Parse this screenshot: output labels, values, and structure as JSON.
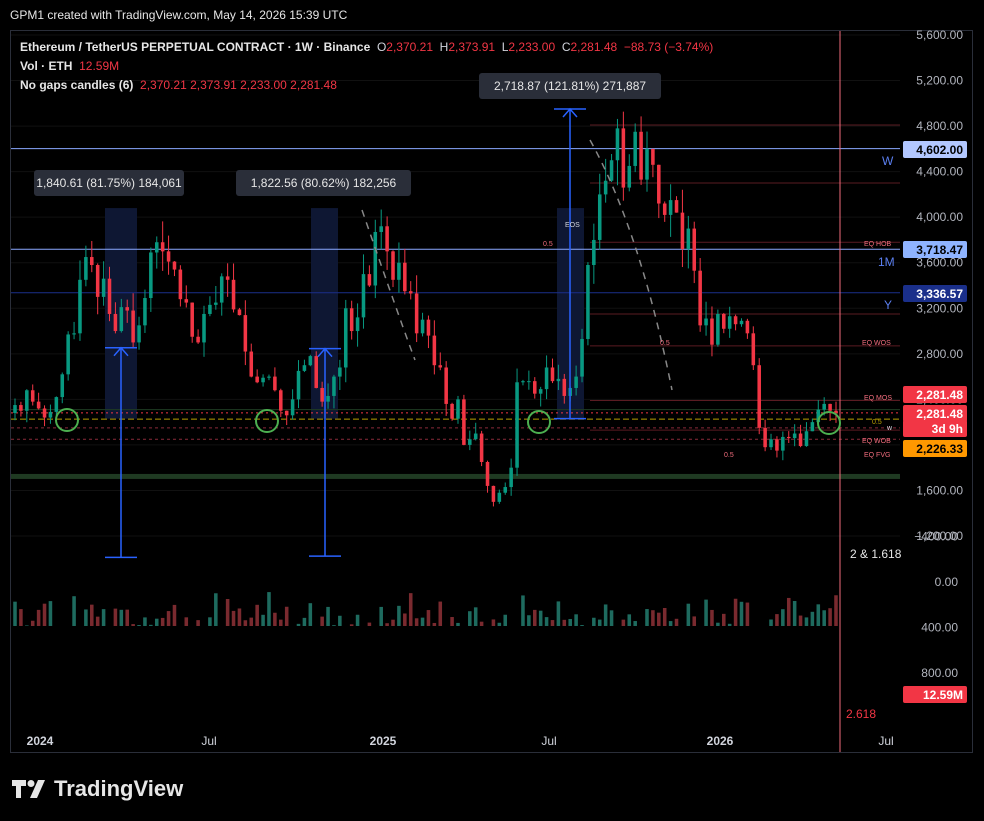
{
  "header": {
    "credit": "GPM1 created with TradingView.com, May 14, 2026 15:39 UTC"
  },
  "legend": {
    "symbol": "Ethereum / TetherUS PERPETUAL CONTRACT · 1W · Binance",
    "o_label": "O",
    "o": "2,370.21",
    "h_label": "H",
    "h": "2,373.91",
    "l_label": "L",
    "l": "2,233.00",
    "c_label": "C",
    "c": "2,281.48",
    "change": "−88.73 (−3.74%)",
    "vol_label": "Vol · ETH",
    "vol": "12.59M",
    "ngc_label": "No gaps candles (6)",
    "ngc_values": "2,370.21  2,373.91  2,233.00  2,281.48"
  },
  "chart_data": {
    "type": "candlestick",
    "timeframe": "1W",
    "price_axis": {
      "ticks": [
        "5,600.00",
        "5,200.00",
        "4,800.00",
        "4,400.00",
        "4,000.00",
        "3,600.00",
        "3,200.00",
        "2,800.00",
        "2,400.00",
        "2,000.00",
        "1,600.00",
        "1,200.00"
      ],
      "range": [
        1200,
        5600
      ]
    },
    "volume_axis": {
      "ticks": [
        "800.00",
        "400.00",
        "0.00",
        "−400.00"
      ]
    },
    "time_axis": [
      "2024",
      "Jul",
      "2025",
      "Jul",
      "2026",
      "Jul"
    ],
    "price_labels": [
      {
        "text": "4,602.00",
        "bg": "#b2c7ff",
        "fg": "#000"
      },
      {
        "text": "3,718.47",
        "bg": "#8fb4ff",
        "fg": "#000"
      },
      {
        "text": "3,336.57",
        "bg": "#1a2f8a",
        "fg": "#ffffff"
      },
      {
        "text": "2,281.48",
        "bg": "#f23645",
        "fg": "#ffffff"
      },
      {
        "text": "2,281.48",
        "bg": "#f23645",
        "fg": "#ffffff"
      },
      {
        "text": "3d 9h",
        "bg": "#f23645",
        "fg": "#ffffff"
      },
      {
        "text": "2,226.33",
        "bg": "#ff9800",
        "fg": "#000"
      },
      {
        "text": "12.59M",
        "bg": "#f23645",
        "fg": "#ffffff"
      }
    ],
    "level_tags": {
      "w": "W",
      "m": "1M",
      "y": "Y"
    },
    "annotations": {
      "measure1": "1,840.61 (81.75%) 184,061",
      "measure2": "1,822.56 (80.62%) 182,256",
      "measure3": "2,718.87 (121.81%) 271,887",
      "fib_note": "2 & 1.618",
      "fib_bottom": "2.618",
      "eos": "EOS",
      "half": "0.5",
      "eq_hob": "EQ HOB",
      "eq_wos": "EQ WOS",
      "eq_mos": "EQ MOS",
      "eq_wob": "EQ WOB",
      "eq_fvg": "EQ FVG",
      "w_small": "w",
      "half_small": "0.5"
    },
    "measures": [
      {
        "from": 1012,
        "to": 2853
      },
      {
        "from": 1023,
        "to": 2846
      },
      {
        "from": 2231,
        "to": 4950
      }
    ],
    "candles_note": "Weekly ETHUSDT candles Jan 2024 – May 2026, approximated from the chart",
    "closes": [
      2350,
      2300,
      2480,
      2380,
      2320,
      2240,
      2290,
      2420,
      2620,
      2970,
      2980,
      3450,
      3650,
      3580,
      3300,
      3460,
      3150,
      3000,
      3210,
      3180,
      2900,
      3050,
      3290,
      3690,
      3780,
      3700,
      3610,
      3540,
      3280,
      3250,
      2950,
      2900,
      3150,
      3230,
      3250,
      3480,
      3450,
      3190,
      3140,
      2820,
      2600,
      2550,
      2590,
      2600,
      2480,
      2300,
      2260,
      2400,
      2650,
      2700,
      2780,
      2500,
      2380,
      2430,
      2600,
      2680,
      3200,
      3000,
      3120,
      3500,
      3400,
      3870,
      3920,
      3700,
      3450,
      3600,
      3350,
      3330,
      2980,
      3100,
      2960,
      2700,
      2680,
      2360,
      2230,
      2400,
      2000,
      2050,
      2100,
      1850,
      1640,
      1500,
      1580,
      1630,
      1800,
      2550,
      2560,
      2560,
      2450,
      2490,
      2680,
      2560,
      2580,
      2430,
      2500,
      2600,
      2930,
      3580,
      3800,
      4200,
      4320,
      4500,
      4780,
      4260,
      4450,
      4750,
      4330,
      4600,
      4460,
      4120,
      4020,
      4150,
      4040,
      3720,
      3900,
      3530,
      3050,
      3110,
      2880,
      3150,
      3020,
      3130,
      3060,
      3090,
      2980,
      2700,
      2150,
      1980,
      2050,
      1950,
      2070,
      2060,
      2100,
      1990,
      2120,
      2200,
      2310,
      2360,
      2300,
      2281
    ]
  }
}
